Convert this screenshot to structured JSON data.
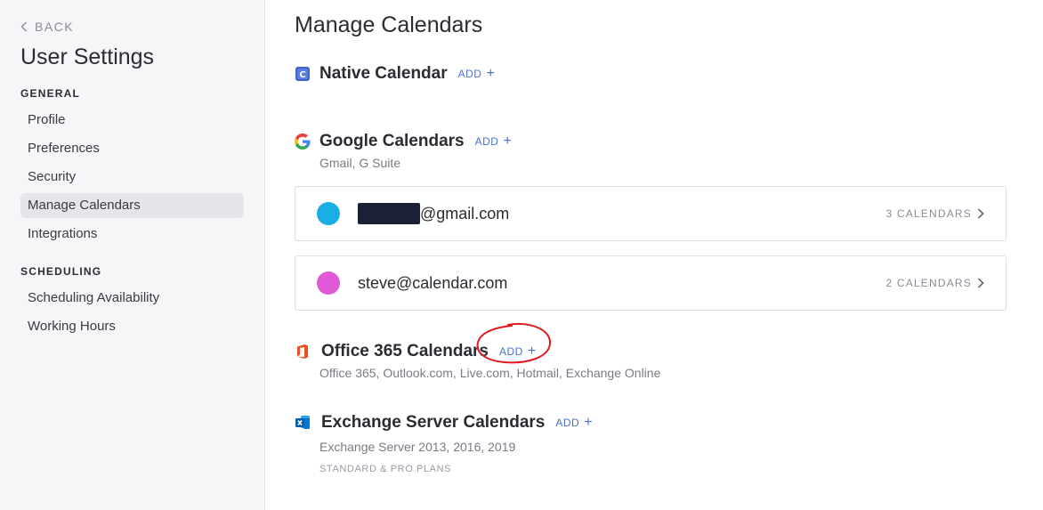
{
  "sidebar": {
    "back_label": "BACK",
    "title": "User Settings",
    "sections": [
      {
        "label": "GENERAL",
        "items": [
          {
            "label": "Profile",
            "active": false
          },
          {
            "label": "Preferences",
            "active": false
          },
          {
            "label": "Security",
            "active": false
          },
          {
            "label": "Manage Calendars",
            "active": true
          },
          {
            "label": "Integrations",
            "active": false
          }
        ]
      },
      {
        "label": "SCHEDULING",
        "items": [
          {
            "label": "Scheduling Availability",
            "active": false
          },
          {
            "label": "Working Hours",
            "active": false
          }
        ]
      }
    ]
  },
  "main": {
    "title": "Manage Calendars",
    "providers": {
      "native": {
        "name": "Native Calendar",
        "add_label": "ADD",
        "icon": "calendar-c-icon"
      },
      "google": {
        "name": "Google Calendars",
        "add_label": "ADD",
        "icon": "google-g-icon",
        "subtitle": "Gmail, G Suite",
        "accounts": [
          {
            "email": "@gmail.com",
            "count": "3 CALENDARS",
            "color": "#1aaee5"
          },
          {
            "email": "steve@calendar.com",
            "count": "2 CALENDARS",
            "color": "#e05ad8"
          }
        ]
      },
      "office": {
        "name": "Office 365 Calendars",
        "add_label": "ADD",
        "icon": "office-365-icon",
        "subtitle": "Office 365, Outlook.com, Live.com, Hotmail, Exchange Online"
      },
      "exchange": {
        "name": "Exchange Server Calendars",
        "add_label": "ADD",
        "icon": "exchange-icon",
        "subtitle": "Exchange Server 2013, 2016, 2019",
        "note": "STANDARD & PRO PLANS"
      }
    }
  },
  "colors": {
    "accent": "#4a6fd0",
    "annotation": "#e0191f",
    "sidebar_bg": "#f6f6f8"
  }
}
